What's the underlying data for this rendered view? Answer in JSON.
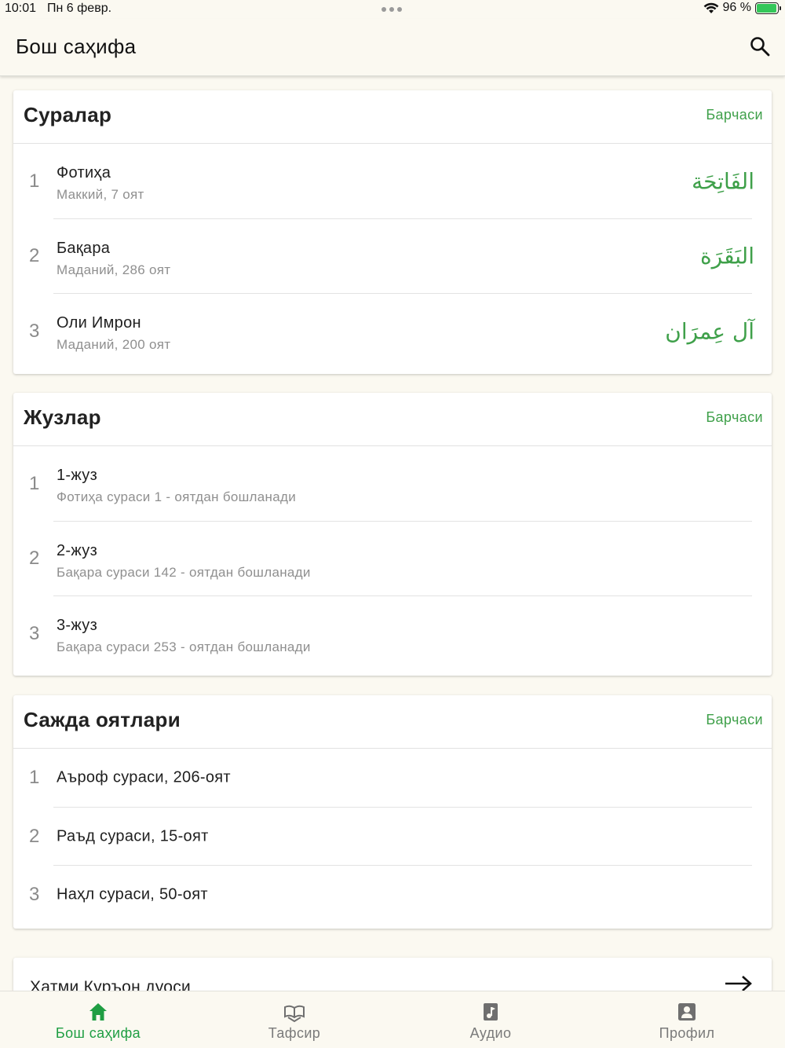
{
  "status_bar": {
    "time": "10:01",
    "date": "Пн 6 февр.",
    "battery": "96 %",
    "battery_level": 0.96
  },
  "app_bar": {
    "title": "Бош саҳифа",
    "search_icon": "search-icon"
  },
  "colors": {
    "accent": "#3fa04a",
    "tab_active": "#1f9e43",
    "background": "#fbf9f1"
  },
  "suras": {
    "title": "Суралар",
    "all_label": "Барчаси",
    "items": [
      {
        "num": "1",
        "name": "Фотиҳа",
        "info": "Маккий, 7 оят",
        "arabic": "الفَاتِحَة"
      },
      {
        "num": "2",
        "name": "Бақара",
        "info": "Маданий, 286 оят",
        "arabic": "البَقَرَة"
      },
      {
        "num": "3",
        "name": "Оли Имрон",
        "info": "Маданий, 200 оят",
        "arabic": "آل عِمرَان"
      }
    ]
  },
  "juz": {
    "title": "Жузлар",
    "all_label": "Барчаси",
    "items": [
      {
        "num": "1",
        "name": "1-жуз",
        "info": "Фотиҳа сураси 1 - оятдан бошланади"
      },
      {
        "num": "2",
        "name": "2-жуз",
        "info": "Бақара сураси 142 - оятдан бошланади"
      },
      {
        "num": "3",
        "name": "3-жуз",
        "info": "Бақара сураси 253 - оятдан бошланади"
      }
    ]
  },
  "sajda": {
    "title": "Сажда оятлари",
    "all_label": "Барчаси",
    "items": [
      {
        "num": "1",
        "name": "Аъроф сураси, 206-оят"
      },
      {
        "num": "2",
        "name": "Раъд сураси, 15-оят"
      },
      {
        "num": "3",
        "name": "Наҳл сураси, 50-оят"
      }
    ]
  },
  "khatm": {
    "label": "Хатми Қуръон дуоси",
    "icon": "arrow-right-icon"
  },
  "tabs": [
    {
      "label": "Бош саҳифа",
      "icon": "home-icon",
      "active": true
    },
    {
      "label": "Тафсир",
      "icon": "book-icon",
      "active": false
    },
    {
      "label": "Аудио",
      "icon": "audio-icon",
      "active": false
    },
    {
      "label": "Профил",
      "icon": "profile-icon",
      "active": false
    }
  ]
}
